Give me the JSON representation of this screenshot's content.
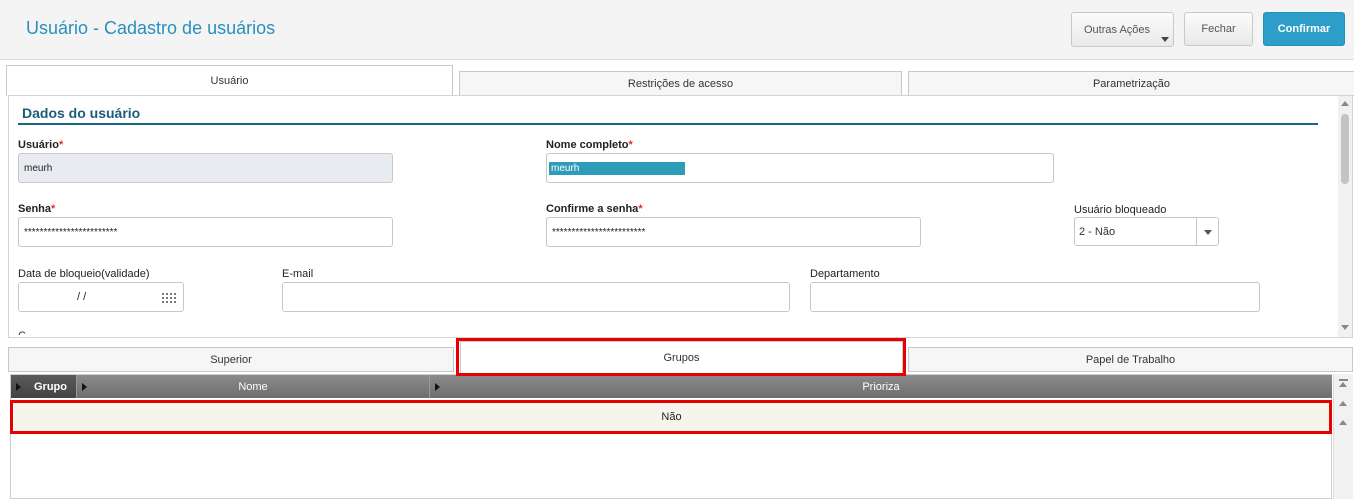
{
  "header": {
    "title": "Usuário - Cadastro de usuários",
    "buttons": {
      "outras_acoes": "Outras Ações",
      "fechar": "Fechar",
      "confirmar": "Confirmar"
    }
  },
  "top_tabs": [
    "Usuário",
    "Restrições de acesso",
    "Parametrização"
  ],
  "section": {
    "title": "Dados do usuário"
  },
  "fields": {
    "usuario": {
      "label": "Usuário",
      "value": "meurh",
      "required": "*"
    },
    "nome_completo": {
      "label": "Nome completo",
      "value": "meurh",
      "required": "*"
    },
    "senha": {
      "label": "Senha",
      "value": "************************",
      "required": "*"
    },
    "confirme_senha": {
      "label": "Confirme a senha",
      "value": "************************",
      "required": "*"
    },
    "usuario_bloqueado": {
      "label": "Usuário bloqueado",
      "value": "2 - Não"
    },
    "data_bloqueio": {
      "label": "Data de bloqueio(validade)",
      "value": "/ /"
    },
    "email": {
      "label": "E-mail",
      "value": ""
    },
    "departamento": {
      "label": "Departamento",
      "value": ""
    },
    "cut_label": "C"
  },
  "bottom_tabs": [
    "Superior",
    "Grupos",
    "Papel de Trabalho"
  ],
  "grid": {
    "columns": [
      "Grupo",
      "Nome",
      "Prioriza"
    ],
    "rows": [
      {
        "grupo": "",
        "nome": "",
        "prioriza": "Não"
      }
    ]
  },
  "colors": {
    "accent": "#2c9ec9",
    "title": "#2a8fbd",
    "section": "#1a5c7a",
    "required": "#e12d2d",
    "highlight": "#e60000"
  },
  "icons": {
    "dropdown": "chevron-down-icon",
    "calendar": "calendar-icon",
    "column_marker": "triangle-right-icon"
  }
}
